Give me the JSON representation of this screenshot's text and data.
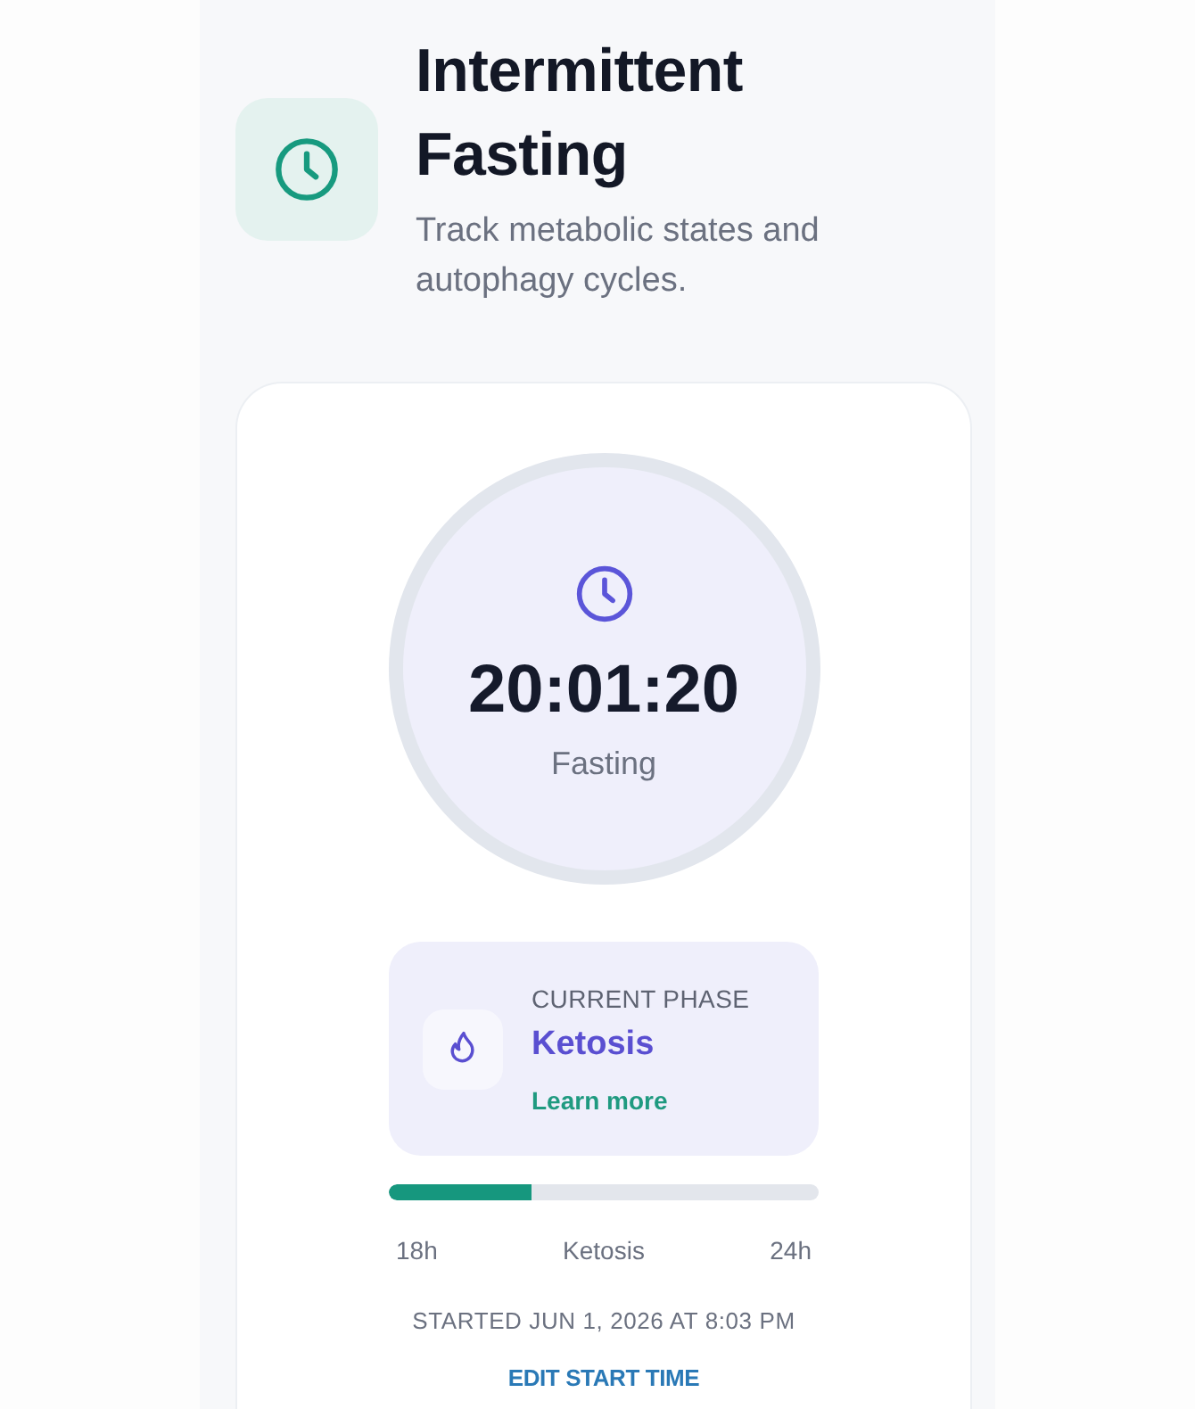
{
  "header": {
    "title": "Intermittent Fasting",
    "subtitle": "Track metabolic states and autophagy cycles."
  },
  "timer": {
    "elapsed": "20:01:20",
    "status": "Fasting"
  },
  "phase": {
    "label": "CURRENT PHASE",
    "name": "Ketosis",
    "link": "Learn more"
  },
  "progress": {
    "level": 0.33,
    "start": "18h",
    "phase": "Ketosis",
    "end": "24h"
  },
  "started": "STARTED JUN 1, 2026 AT 8:03 PM",
  "edit_button": "EDIT START TIME"
}
